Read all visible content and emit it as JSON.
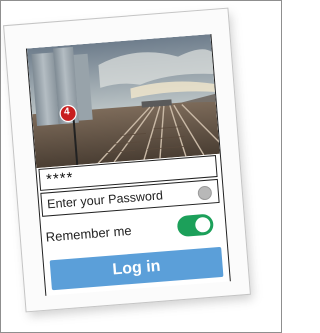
{
  "login": {
    "pin_value": "****",
    "password_placeholder": "Enter your Password",
    "remember_label": "Remember me",
    "remember_on": true,
    "login_button": "Log in",
    "photo_badge": "4"
  },
  "colors": {
    "toggle_on": "#1ca05a",
    "button_bg": "#5b9fd9",
    "badge": "#c81e1e"
  },
  "icons": {
    "password_reveal": "eye-icon"
  }
}
